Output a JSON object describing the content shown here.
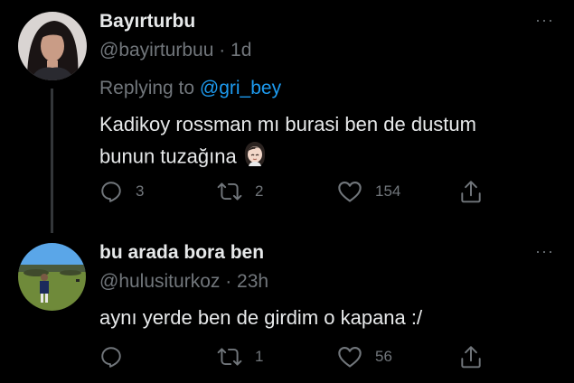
{
  "tweets": [
    {
      "display_name": "Bayırturbu",
      "handle_time": "@bayirturbuu · 1d",
      "replying_prefix": "Replying to ",
      "replying_mention": "@gri_bey",
      "text_line1": "Kadikoy rossman mı burasi ben de dustum",
      "text_line2": "bunun tuzağına",
      "more_label": "···",
      "reply_count": "3",
      "retweet_count": "2",
      "like_count": "154"
    },
    {
      "display_name": "bu arada bora ben",
      "handle_time": "@hulusiturkoz · 23h",
      "text_line1": "aynı yerde ben de girdim o kapana :/",
      "more_label": "···",
      "reply_count": "",
      "retweet_count": "1",
      "like_count": "56"
    }
  ],
  "colors": {
    "background": "#000000",
    "primary_text": "#e7e9ea",
    "secondary_text": "#71767b",
    "mention": "#1d9bf0"
  },
  "icons": [
    "reply-icon",
    "retweet-icon",
    "like-icon",
    "share-icon",
    "more-icon",
    "facepalm-emoji"
  ]
}
